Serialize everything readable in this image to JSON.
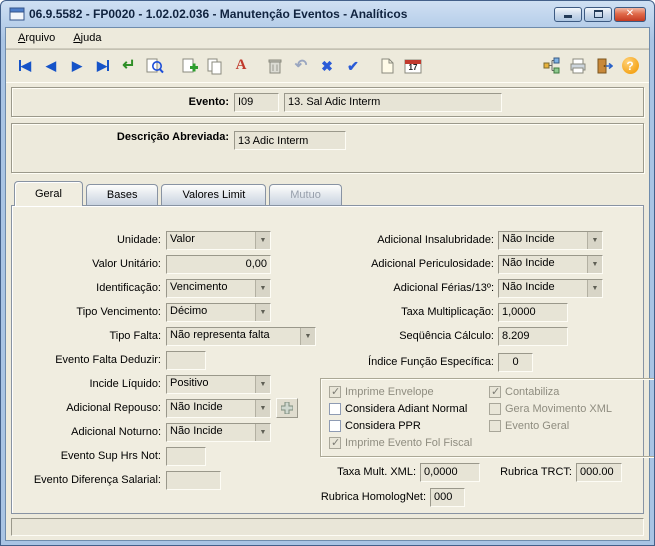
{
  "window": {
    "title": "06.9.5582 - FP0020 - 1.02.02.036 - Manutenção Eventos - Analíticos",
    "controls": {
      "minimize": "minimize",
      "maximize": "maximize",
      "close_glyph": "✕"
    }
  },
  "menu": {
    "items": [
      {
        "label": "Arquivo",
        "accel": "A",
        "rest": "rquivo"
      },
      {
        "label": "Ajuda",
        "accel": "A",
        "rest": "juda"
      }
    ]
  },
  "ui": {
    "combo_arrow": "▼"
  },
  "toolbar": {
    "calendar_day": "17",
    "icons": [
      {
        "name": "first-record",
        "glyph": "◀"
      },
      {
        "name": "previous-record",
        "glyph": "◀"
      },
      {
        "name": "next-record",
        "glyph": "▶"
      },
      {
        "name": "last-record",
        "glyph": "▶"
      },
      {
        "name": "go",
        "glyph": "↵"
      },
      {
        "name": "search",
        "glyph": ""
      },
      {
        "name": "add-record",
        "glyph": ""
      },
      {
        "name": "copy-record",
        "glyph": ""
      },
      {
        "name": "edit-font",
        "glyph": "A"
      },
      {
        "name": "delete-record",
        "glyph": ""
      },
      {
        "name": "undo",
        "glyph": "↶"
      },
      {
        "name": "cancel",
        "glyph": "✖"
      },
      {
        "name": "confirm",
        "glyph": "✔"
      },
      {
        "name": "new-note",
        "glyph": ""
      },
      {
        "name": "calendar",
        "glyph": ""
      },
      {
        "name": "related-programs",
        "glyph": ""
      },
      {
        "name": "print",
        "glyph": ""
      },
      {
        "name": "exit",
        "glyph": ""
      },
      {
        "name": "help",
        "glyph": "?"
      }
    ]
  },
  "header": {
    "evento_label": "Evento:",
    "evento_code": "I09",
    "evento_desc": "13. Sal Adic Interm",
    "descricao_label": "Descrição Abreviada:",
    "descricao_value": "13 Adic Interm"
  },
  "tabs": [
    {
      "label": "Geral",
      "state": "active"
    },
    {
      "label": "Bases",
      "state": "inactive"
    },
    {
      "label": "Valores Limit",
      "state": "inactive"
    },
    {
      "label": "Mutuo",
      "state": "disabled"
    }
  ],
  "form_left": [
    {
      "label": "Unidade:",
      "value": "Valor"
    },
    {
      "label": "Valor Unitário:",
      "value": "0,00"
    },
    {
      "label": "Identificação:",
      "value": "Vencimento"
    },
    {
      "label": "Tipo Vencimento:",
      "value": "Décimo"
    },
    {
      "label": "Tipo Falta:",
      "value": "Não representa falta"
    },
    {
      "label": "Evento Falta Deduzir:",
      "value": ""
    },
    {
      "label": "Incide Líquido:",
      "value": "Positivo"
    },
    {
      "label": "Adicional Repouso:",
      "value": "Não Incide"
    },
    {
      "label": "Adicional Noturno:",
      "value": "Não Incide"
    },
    {
      "label": "Evento Sup Hrs Not:",
      "value": ""
    },
    {
      "label": "Evento Diferença Salarial:",
      "value": ""
    }
  ],
  "form_right": [
    {
      "label": "Adicional Insalubridade:",
      "value": "Não Incide"
    },
    {
      "label": "Adicional Periculosidade:",
      "value": "Não Incide"
    },
    {
      "label": "Adicional Férias/13º:",
      "value": "Não Incide"
    },
    {
      "label": "Taxa Multiplicação:",
      "value": "1,0000"
    },
    {
      "label": "Seqüência Cálculo:",
      "value": "8.209"
    },
    {
      "label": "Índice Função Específica:",
      "value": "0"
    }
  ],
  "checkboxes": [
    {
      "label": "Imprime Envelope",
      "state": "checked disabled"
    },
    {
      "label": "Considera Adiant Normal",
      "state": "unchecked"
    },
    {
      "label": "Considera PPR",
      "state": "unchecked"
    },
    {
      "label": "Imprime Evento Fol Fiscal",
      "state": "checked disabled"
    },
    {
      "label": "Contabiliza",
      "state": "checked disabled"
    },
    {
      "label": "Gera Movimento XML",
      "state": "unchecked disabled"
    },
    {
      "label": "Evento Geral",
      "state": "unchecked disabled"
    }
  ],
  "xml_fields": [
    {
      "label": "Taxa Mult. XML:",
      "value": "0,0000"
    },
    {
      "label": "Rubrica TRCT:",
      "value": "000.00"
    },
    {
      "label": "Rubrica HomologNet:",
      "value": "000"
    }
  ]
}
